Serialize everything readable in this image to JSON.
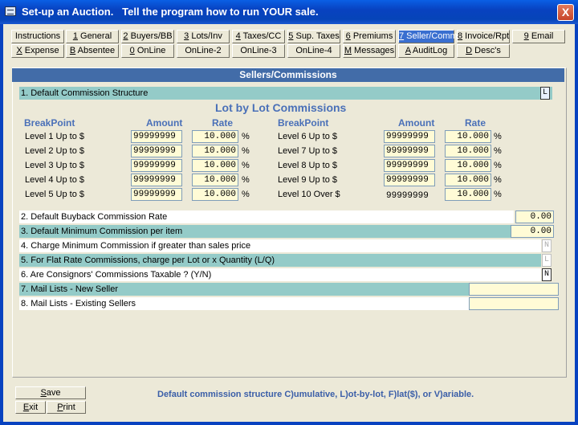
{
  "window": {
    "title": "Set-up an Auction.   Tell the program how to run YOUR sale.",
    "close": "X"
  },
  "tabs_row1": [
    {
      "pre": "",
      "ul": "",
      "post": "Instructions",
      "active": false
    },
    {
      "pre": "",
      "ul": "1",
      "post": " General",
      "active": false
    },
    {
      "pre": "",
      "ul": "2",
      "post": " Buyers/BB",
      "active": false
    },
    {
      "pre": "",
      "ul": "3",
      "post": " Lots/Inv",
      "active": false
    },
    {
      "pre": "",
      "ul": "4",
      "post": " Taxes/CC",
      "active": false
    },
    {
      "pre": "",
      "ul": "5",
      "post": " Sup. Taxes",
      "active": false
    },
    {
      "pre": "",
      "ul": "6",
      "post": " Premiums",
      "active": false
    },
    {
      "pre": "",
      "ul": "7",
      "post": " Seller/Comm",
      "active": true
    },
    {
      "pre": "",
      "ul": "8",
      "post": " Invoice/Rpt",
      "active": false
    },
    {
      "pre": "",
      "ul": "9",
      "post": " Email",
      "active": false
    }
  ],
  "tabs_row2": [
    {
      "pre": "",
      "ul": "X",
      "post": " Expense"
    },
    {
      "pre": "",
      "ul": "B",
      "post": " Absentee"
    },
    {
      "pre": "",
      "ul": "0",
      "post": " OnLine"
    },
    {
      "pre": "",
      "ul": "",
      "post": "OnLine-2"
    },
    {
      "pre": "",
      "ul": "",
      "post": "OnLine-3"
    },
    {
      "pre": "",
      "ul": "",
      "post": "OnLine-4"
    },
    {
      "pre": "",
      "ul": "M",
      "post": " Messages"
    },
    {
      "pre": "",
      "ul": "A",
      "post": " AuditLog"
    },
    {
      "pre": "",
      "ul": "D",
      "post": " Desc's"
    }
  ],
  "section_title": "Sellers/Commissions",
  "default_commission_structure": {
    "label": "1. Default Commission Structure",
    "value": "L"
  },
  "lot_title": "Lot by Lot Commissions",
  "columns": {
    "breakpoint": "BreakPoint",
    "amount": "Amount",
    "rate": "Rate"
  },
  "levels_left": [
    {
      "label": "Level 1 Up to $",
      "amount": "99999999",
      "rate": "10.000"
    },
    {
      "label": "Level 2 Up to $",
      "amount": "99999999",
      "rate": "10.000"
    },
    {
      "label": "Level 3 Up to $",
      "amount": "99999999",
      "rate": "10.000"
    },
    {
      "label": "Level 4 Up to $",
      "amount": "99999999",
      "rate": "10.000"
    },
    {
      "label": "Level 5 Up to $",
      "amount": "99999999",
      "rate": "10.000"
    }
  ],
  "levels_right": [
    {
      "label": "Level 6 Up to $",
      "amount": "99999999",
      "rate": "10.000"
    },
    {
      "label": "Level 7 Up to $",
      "amount": "99999999",
      "rate": "10.000"
    },
    {
      "label": "Level 8 Up to $",
      "amount": "99999999",
      "rate": "10.000"
    },
    {
      "label": "Level 9 Up to $",
      "amount": "99999999",
      "rate": "10.000"
    },
    {
      "label": "Level 10 Over $",
      "amount": "99999999",
      "rate": "10.000"
    }
  ],
  "pct": "%",
  "settings": [
    {
      "label": "2. Default Buyback Commission Rate",
      "value": "0.00"
    },
    {
      "label": "3. Default Minimum Commission per item",
      "value": "0.00"
    },
    {
      "label": "4. Charge Minimum Commission if greater than sales price",
      "value": "N"
    },
    {
      "label": "5. For Flat Rate Commissions, charge per Lot or x Quantity (L/Q)",
      "value": "L"
    },
    {
      "label": "6. Are Consignors' Commissions Taxable ? (Y/N)",
      "value": "N"
    },
    {
      "label": "7. Mail Lists - New Seller",
      "value": ""
    },
    {
      "label": "8. Mail Lists - Existing Sellers",
      "value": ""
    }
  ],
  "buttons": {
    "save": {
      "ul": "S",
      "post": "ave"
    },
    "exit": {
      "ul": "E",
      "post": "xit"
    },
    "print": {
      "ul": "P",
      "post": "rint"
    }
  },
  "status": "Default commission structure C)umulative, L)ot-by-lot, F)lat($), or V)ariable."
}
